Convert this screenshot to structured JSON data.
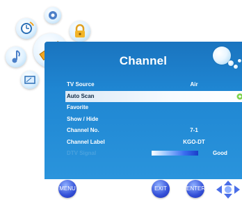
{
  "header": {
    "title": "Channel"
  },
  "menu": {
    "items": [
      {
        "label": "TV Source",
        "value": "Air"
      },
      {
        "label": "Auto Scan",
        "value": ""
      },
      {
        "label": "Favorite",
        "value": ""
      },
      {
        "label": "Show / Hide",
        "value": ""
      },
      {
        "label": "Channel No.",
        "value": "7-1"
      },
      {
        "label": "Channel Label",
        "value": "KGO-DT"
      },
      {
        "label": "DTV Signal",
        "value": "Good"
      }
    ],
    "selected_index": 1,
    "dtv_signal_level": 0.9
  },
  "nav_icons": [
    "timer-icon",
    "lock-icon",
    "music-icon",
    "satellite-icon",
    "screen-icon"
  ],
  "footer": {
    "menu_label": "MENU",
    "exit_label": "EXIT",
    "enter_label": "ENTER"
  },
  "colors": {
    "panel": "#1f86d2",
    "selected_row": "#f7fbff",
    "button": "#3450d8"
  }
}
